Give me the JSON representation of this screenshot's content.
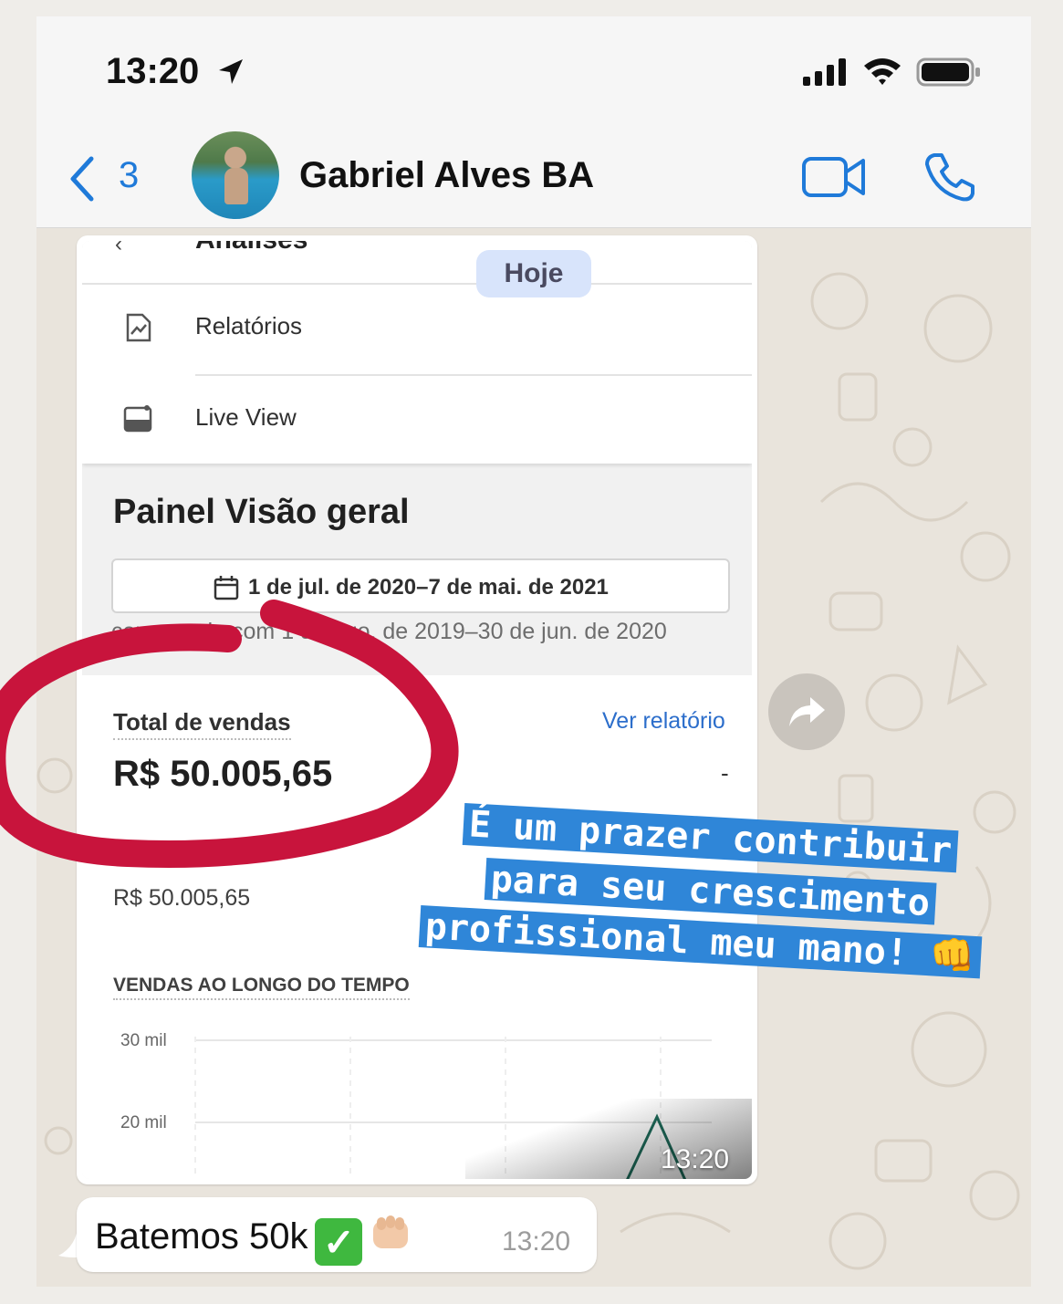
{
  "status_bar": {
    "time": "13:20"
  },
  "chat_header": {
    "unread_count": "3",
    "contact_name": "Gabriel Alves BA"
  },
  "image_message": {
    "date_chip": "Hoje",
    "menu_partial": "Análises",
    "menu_items": [
      {
        "label": "Relatórios",
        "icon": "report-icon"
      },
      {
        "label": "Live View",
        "icon": "live-view-icon"
      }
    ],
    "panel_title": "Painel Visão geral",
    "date_range": "1 de jul. de 2020–7 de mai. de 2021",
    "compare_text": "comparado com 1 de ago. de 2019–30 de jun. de 2020",
    "sales_label": "Total de vendas",
    "ver_relatorio": "Ver relatório",
    "sales_value": "R$ 50.005,65",
    "sales_dash": "-",
    "sales_sub": "R$ 50.005,65",
    "chart_title": "VENDAS AO LONGO DO TEMPO",
    "chart_ticks": [
      "30 mil",
      "20 mil"
    ],
    "timestamp": "13:20"
  },
  "text_message": {
    "text": "Batemos 50k",
    "timestamp": "13:20"
  },
  "story_overlay": {
    "line1": "É um prazer contribuir",
    "line2": "para seu crescimento",
    "line3": "profissional meu mano! 👊"
  },
  "colors": {
    "accent_blue": "#1f7ad9",
    "overlay_blue": "#2f86d8",
    "marker_red": "#c8143c",
    "chart_line": "#1e6b5a"
  }
}
